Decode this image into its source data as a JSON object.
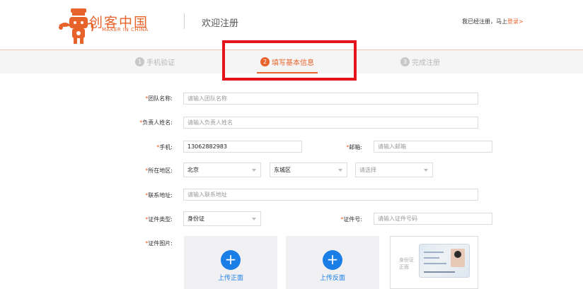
{
  "header": {
    "brand_cn": "创客中国",
    "brand_en": "MAKER IN CHINA",
    "page_title": "欢迎注册",
    "login_prompt": "我已经注册，马上",
    "login_link": "登录>",
    "brand_color": "#e8632b"
  },
  "steps": [
    {
      "num": "1",
      "label": "手机验证",
      "active": false
    },
    {
      "num": "2",
      "label": "填写基本信息",
      "active": true
    },
    {
      "num": "3",
      "label": "完成注册",
      "active": false
    }
  ],
  "form": {
    "team_name": {
      "label": "团队名称:",
      "placeholder": "请输入团队名称"
    },
    "leader_name": {
      "label": "负责人姓名:",
      "placeholder": "请输入负责人姓名"
    },
    "phone": {
      "label": "手机:",
      "value": "13062882983"
    },
    "email": {
      "label": "邮箱:",
      "placeholder": "请输入邮箱"
    },
    "region": {
      "label": "所在地区:",
      "province": "北京",
      "district": "东城区",
      "street_placeholder": "请选择"
    },
    "address": {
      "label": "联系地址:",
      "placeholder": "请输入联系地址"
    },
    "id_type": {
      "label": "证件类型:",
      "value": "身份证"
    },
    "id_number": {
      "label": "证件号:",
      "placeholder": "请输入证件号码"
    },
    "id_images": {
      "label": "证件图片:",
      "upload_front": "上传正面",
      "upload_back": "上传反面",
      "sample_label": "身份证正面"
    },
    "required_mark": "*"
  },
  "colors": {
    "accent": "#e8632b",
    "upload_blue": "#1a7ee6",
    "highlight_red": "#e3141b"
  }
}
